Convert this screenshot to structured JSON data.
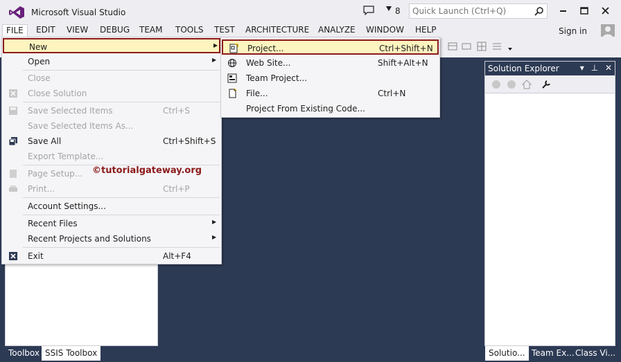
{
  "window": {
    "title": "Microsoft Visual Studio",
    "notification_count": "8",
    "quick_launch_placeholder": "Quick Launch (Ctrl+Q)",
    "sign_in": "Sign in"
  },
  "menubar": {
    "items": [
      "FILE",
      "EDIT",
      "VIEW",
      "DEBUG",
      "TEAM",
      "TOOLS",
      "TEST",
      "ARCHITECTURE",
      "ANALYZE",
      "WINDOW",
      "HELP"
    ],
    "active": "FILE"
  },
  "file_menu": {
    "items": [
      {
        "label": "New",
        "shortcut": "",
        "submenu": true,
        "enabled": true,
        "icon": "",
        "highlighted": true
      },
      {
        "label": "Open",
        "shortcut": "",
        "submenu": true,
        "enabled": true,
        "icon": ""
      },
      {
        "label": "Close",
        "shortcut": "",
        "enabled": false,
        "icon": ""
      },
      {
        "label": "Close Solution",
        "shortcut": "",
        "enabled": false,
        "icon": "close-solution-icon"
      },
      {
        "label": "Save Selected Items",
        "shortcut": "Ctrl+S",
        "enabled": false,
        "icon": "save-icon"
      },
      {
        "label": "Save Selected Items As...",
        "shortcut": "",
        "enabled": false,
        "icon": ""
      },
      {
        "label": "Save All",
        "shortcut": "Ctrl+Shift+S",
        "enabled": true,
        "icon": "save-all-icon"
      },
      {
        "label": "Export Template...",
        "shortcut": "",
        "enabled": false,
        "icon": ""
      },
      {
        "label": "Page Setup...",
        "shortcut": "",
        "enabled": false,
        "icon": "page-setup-icon"
      },
      {
        "label": "Print...",
        "shortcut": "Ctrl+P",
        "enabled": false,
        "icon": "print-icon"
      },
      {
        "label": "Account Settings...",
        "shortcut": "",
        "enabled": true,
        "icon": ""
      },
      {
        "label": "Recent Files",
        "shortcut": "",
        "submenu": true,
        "enabled": true,
        "icon": ""
      },
      {
        "label": "Recent Projects and Solutions",
        "shortcut": "",
        "submenu": true,
        "enabled": true,
        "icon": ""
      },
      {
        "label": "Exit",
        "shortcut": "Alt+F4",
        "enabled": true,
        "icon": "exit-icon"
      }
    ]
  },
  "new_menu": {
    "items": [
      {
        "label": "Project...",
        "shortcut": "Ctrl+Shift+N",
        "icon": "new-project-icon",
        "highlighted": true
      },
      {
        "label": "Web Site...",
        "shortcut": "Shift+Alt+N",
        "icon": "web-site-icon"
      },
      {
        "label": "Team Project...",
        "shortcut": "",
        "icon": "team-project-icon"
      },
      {
        "label": "File...",
        "shortcut": "Ctrl+N",
        "icon": "new-file-icon"
      },
      {
        "label": "Project From Existing Code...",
        "shortcut": "",
        "icon": ""
      }
    ]
  },
  "solution_explorer": {
    "title": "Solution Explorer"
  },
  "bottom_tabs": {
    "left": [
      "Toolbox",
      "SSIS Toolbox"
    ],
    "left_selected": "SSIS Toolbox",
    "right": [
      "Solutio...",
      "Team Ex...",
      "Class Vi..."
    ],
    "right_selected": "Solutio..."
  },
  "watermark": "©tutorialgateway.org",
  "colors": {
    "background": "#2d3a54",
    "chrome": "#eeeef2",
    "highlight": "#fdf4bf",
    "highlight_border": "#8b1a1a",
    "vs_purple": "#68217a"
  }
}
